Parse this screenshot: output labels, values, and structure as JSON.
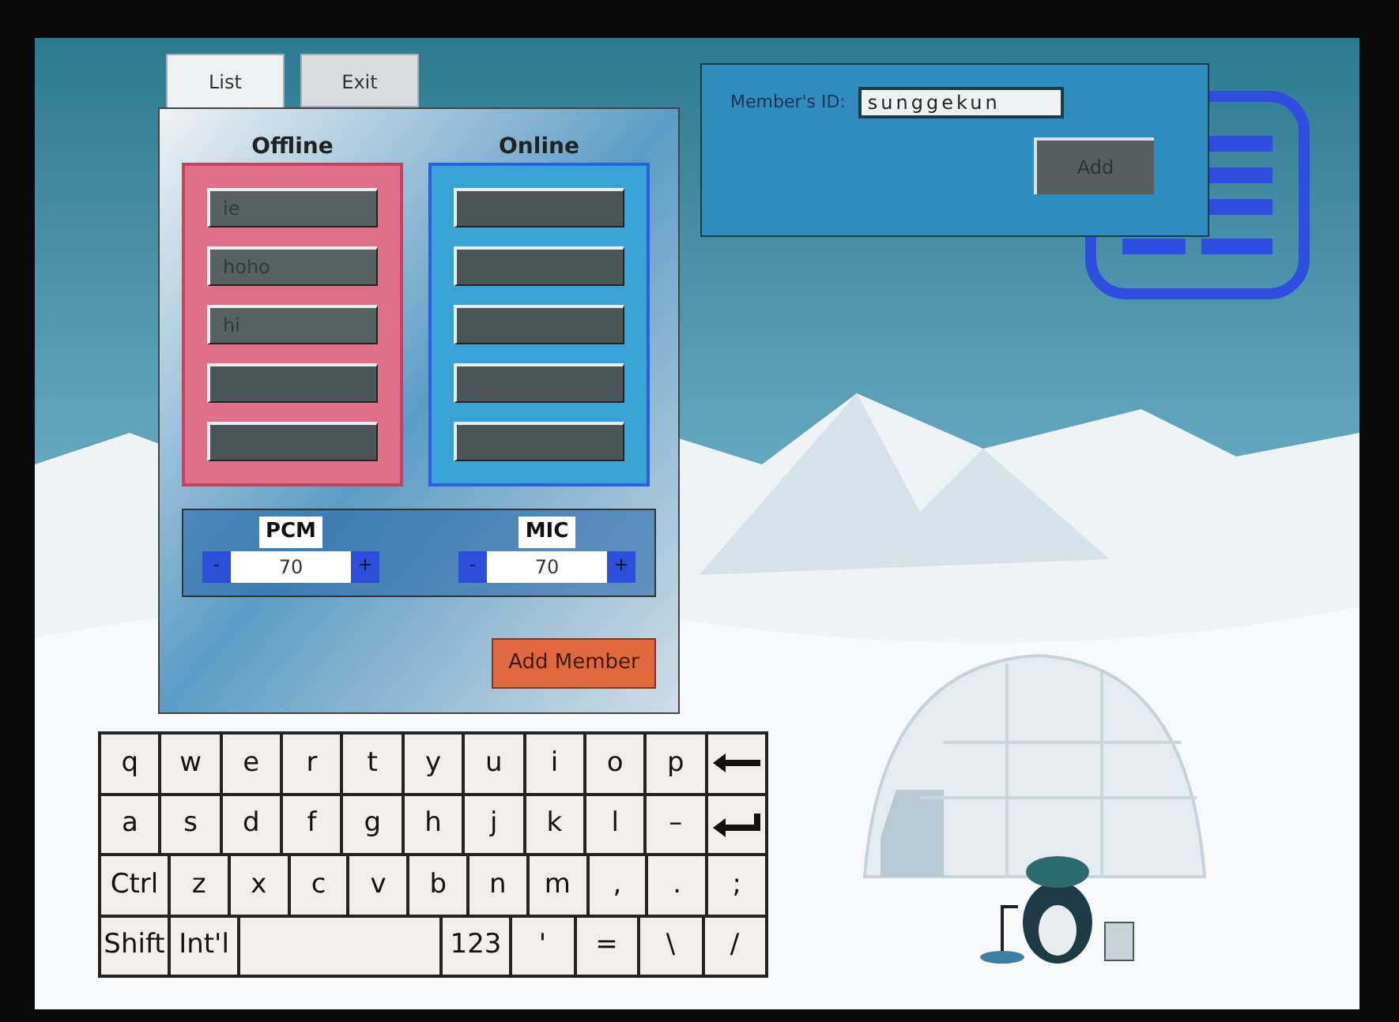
{
  "tabs": [
    {
      "label": "List",
      "selected": true
    },
    {
      "label": "Exit",
      "selected": false
    }
  ],
  "offline": {
    "title": "Offline",
    "entries": [
      {
        "kind": "member",
        "name": "ie"
      },
      {
        "kind": "member",
        "name": "hoho"
      },
      {
        "kind": "member",
        "name": "hi"
      },
      {
        "kind": "empty"
      },
      {
        "kind": "empty"
      }
    ]
  },
  "online": {
    "title": "Online",
    "entries": [
      {
        "kind": "empty"
      },
      {
        "kind": "empty"
      },
      {
        "kind": "empty"
      },
      {
        "kind": "empty"
      },
      {
        "kind": "empty"
      }
    ]
  },
  "volumes": [
    {
      "label": "PCM",
      "minus": "-",
      "value": "70",
      "plus": "+"
    },
    {
      "label": "MIC",
      "minus": "-",
      "value": "70",
      "plus": "+"
    }
  ],
  "add_member_button": "Add Member",
  "member_dialog": {
    "label": "Member's ID:",
    "value": "sunggekun",
    "button": "Add"
  },
  "keyboard": [
    [
      {
        "kind": "key",
        "label": "q"
      },
      {
        "kind": "key",
        "label": "w"
      },
      {
        "kind": "key",
        "label": "e"
      },
      {
        "kind": "key",
        "label": "r"
      },
      {
        "kind": "key",
        "label": "t"
      },
      {
        "kind": "key",
        "label": "y"
      },
      {
        "kind": "key",
        "label": "u"
      },
      {
        "kind": "key",
        "label": "i"
      },
      {
        "kind": "key",
        "label": "o"
      },
      {
        "kind": "key",
        "label": "p"
      },
      {
        "kind": "backspace"
      }
    ],
    [
      {
        "kind": "key",
        "label": "a"
      },
      {
        "kind": "key",
        "label": "s"
      },
      {
        "kind": "key",
        "label": "d"
      },
      {
        "kind": "key",
        "label": "f"
      },
      {
        "kind": "key",
        "label": "g"
      },
      {
        "kind": "key",
        "label": "h"
      },
      {
        "kind": "key",
        "label": "j"
      },
      {
        "kind": "key",
        "label": "k"
      },
      {
        "kind": "key",
        "label": "l"
      },
      {
        "kind": "key",
        "label": "–"
      },
      {
        "kind": "enter"
      }
    ],
    [
      {
        "kind": "wide",
        "label": "Ctrl"
      },
      {
        "kind": "key",
        "label": "z"
      },
      {
        "kind": "key",
        "label": "x"
      },
      {
        "kind": "key",
        "label": "c"
      },
      {
        "kind": "key",
        "label": "v"
      },
      {
        "kind": "key",
        "label": "b"
      },
      {
        "kind": "key",
        "label": "n"
      },
      {
        "kind": "key",
        "label": "m"
      },
      {
        "kind": "key",
        "label": ","
      },
      {
        "kind": "key",
        "label": "."
      },
      {
        "kind": "key",
        "label": ";"
      }
    ],
    [
      {
        "kind": "wide",
        "label": "Shift"
      },
      {
        "kind": "wide",
        "label": "Int'l"
      },
      {
        "kind": "space"
      },
      {
        "kind": "wide",
        "label": "123"
      },
      {
        "kind": "key",
        "label": "'"
      },
      {
        "kind": "key",
        "label": "="
      },
      {
        "kind": "key",
        "label": "\\"
      },
      {
        "kind": "key",
        "label": "/"
      }
    ]
  ]
}
